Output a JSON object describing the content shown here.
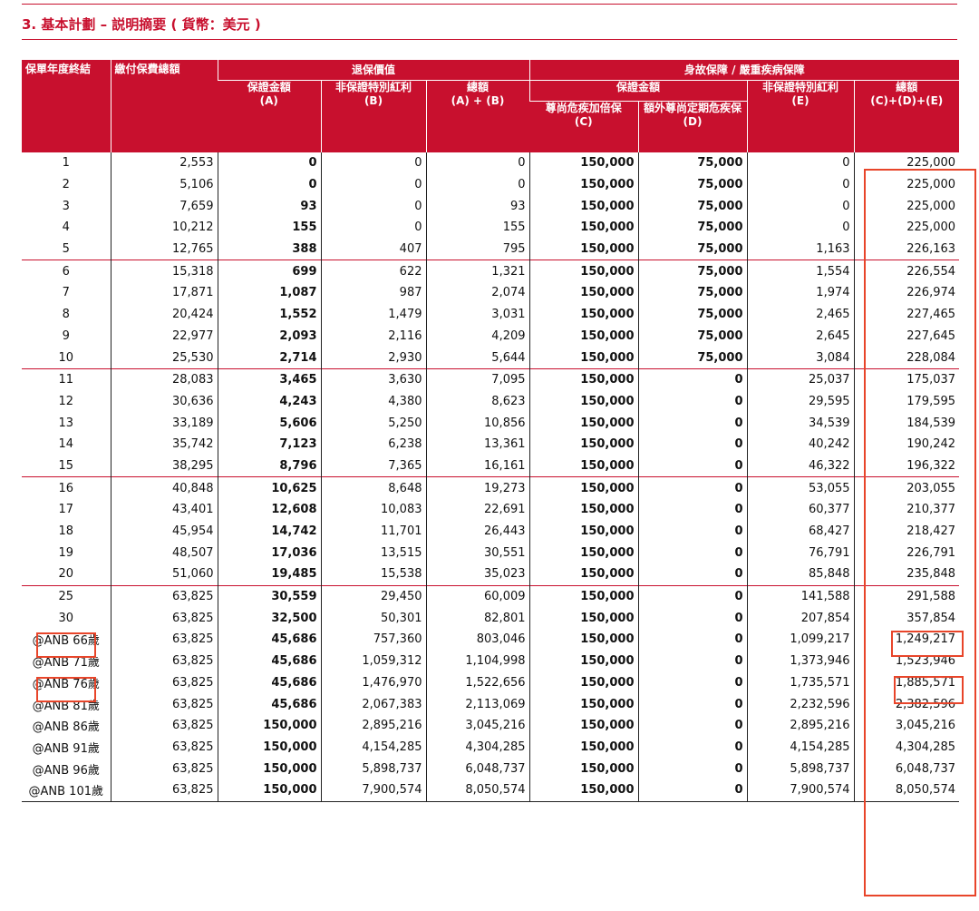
{
  "title": "3. 基本計劃 – 説明摘要 ( 貨幣：美元 )",
  "headers": {
    "policy_year": "保單年度終結",
    "premium": "繳付保費總額",
    "surrender_group": "退保價值",
    "death_group": "身故保障 / 嚴重疾病保障",
    "guaranteed": "保證金額",
    "guaranteed_code": "(A)",
    "nonguar_bonus": "非保證特別紅利",
    "nonguar_bonus_code": "(B)",
    "surrender_total": "總額",
    "surrender_total_code": "(A) + (B)",
    "death_guaranteed": "保證金額",
    "death_nonguar": "非保證特別紅利",
    "death_nonguar_code": "(E)",
    "death_total": "總額",
    "death_total_code": "(C)+(D)+(E)",
    "double_cover": "尊尚危疾加倍保",
    "double_cover_code": "(C)",
    "term_cover": "額外尊尚定期危疾保",
    "term_cover_code": "(D)"
  },
  "rows": [
    {
      "y": "1",
      "p": "2,553",
      "a": "0",
      "b": "0",
      "ab": "0",
      "c": "150,000",
      "d": "75,000",
      "e": "0",
      "t": "225,000"
    },
    {
      "y": "2",
      "p": "5,106",
      "a": "0",
      "b": "0",
      "ab": "0",
      "c": "150,000",
      "d": "75,000",
      "e": "0",
      "t": "225,000"
    },
    {
      "y": "3",
      "p": "7,659",
      "a": "93",
      "b": "0",
      "ab": "93",
      "c": "150,000",
      "d": "75,000",
      "e": "0",
      "t": "225,000"
    },
    {
      "y": "4",
      "p": "10,212",
      "a": "155",
      "b": "0",
      "ab": "155",
      "c": "150,000",
      "d": "75,000",
      "e": "0",
      "t": "225,000"
    },
    {
      "y": "5",
      "p": "12,765",
      "a": "388",
      "b": "407",
      "ab": "795",
      "c": "150,000",
      "d": "75,000",
      "e": "1,163",
      "t": "226,163"
    },
    {
      "y": "6",
      "p": "15,318",
      "a": "699",
      "b": "622",
      "ab": "1,321",
      "c": "150,000",
      "d": "75,000",
      "e": "1,554",
      "t": "226,554"
    },
    {
      "y": "7",
      "p": "17,871",
      "a": "1,087",
      "b": "987",
      "ab": "2,074",
      "c": "150,000",
      "d": "75,000",
      "e": "1,974",
      "t": "226,974"
    },
    {
      "y": "8",
      "p": "20,424",
      "a": "1,552",
      "b": "1,479",
      "ab": "3,031",
      "c": "150,000",
      "d": "75,000",
      "e": "2,465",
      "t": "227,465"
    },
    {
      "y": "9",
      "p": "22,977",
      "a": "2,093",
      "b": "2,116",
      "ab": "4,209",
      "c": "150,000",
      "d": "75,000",
      "e": "2,645",
      "t": "227,645"
    },
    {
      "y": "10",
      "p": "25,530",
      "a": "2,714",
      "b": "2,930",
      "ab": "5,644",
      "c": "150,000",
      "d": "75,000",
      "e": "3,084",
      "t": "228,084"
    },
    {
      "y": "11",
      "p": "28,083",
      "a": "3,465",
      "b": "3,630",
      "ab": "7,095",
      "c": "150,000",
      "d": "0",
      "e": "25,037",
      "t": "175,037"
    },
    {
      "y": "12",
      "p": "30,636",
      "a": "4,243",
      "b": "4,380",
      "ab": "8,623",
      "c": "150,000",
      "d": "0",
      "e": "29,595",
      "t": "179,595"
    },
    {
      "y": "13",
      "p": "33,189",
      "a": "5,606",
      "b": "5,250",
      "ab": "10,856",
      "c": "150,000",
      "d": "0",
      "e": "34,539",
      "t": "184,539"
    },
    {
      "y": "14",
      "p": "35,742",
      "a": "7,123",
      "b": "6,238",
      "ab": "13,361",
      "c": "150,000",
      "d": "0",
      "e": "40,242",
      "t": "190,242"
    },
    {
      "y": "15",
      "p": "38,295",
      "a": "8,796",
      "b": "7,365",
      "ab": "16,161",
      "c": "150,000",
      "d": "0",
      "e": "46,322",
      "t": "196,322"
    },
    {
      "y": "16",
      "p": "40,848",
      "a": "10,625",
      "b": "8,648",
      "ab": "19,273",
      "c": "150,000",
      "d": "0",
      "e": "53,055",
      "t": "203,055"
    },
    {
      "y": "17",
      "p": "43,401",
      "a": "12,608",
      "b": "10,083",
      "ab": "22,691",
      "c": "150,000",
      "d": "0",
      "e": "60,377",
      "t": "210,377"
    },
    {
      "y": "18",
      "p": "45,954",
      "a": "14,742",
      "b": "11,701",
      "ab": "26,443",
      "c": "150,000",
      "d": "0",
      "e": "68,427",
      "t": "218,427"
    },
    {
      "y": "19",
      "p": "48,507",
      "a": "17,036",
      "b": "13,515",
      "ab": "30,551",
      "c": "150,000",
      "d": "0",
      "e": "76,791",
      "t": "226,791"
    },
    {
      "y": "20",
      "p": "51,060",
      "a": "19,485",
      "b": "15,538",
      "ab": "35,023",
      "c": "150,000",
      "d": "0",
      "e": "85,848",
      "t": "235,848"
    },
    {
      "y": "25",
      "p": "63,825",
      "a": "30,559",
      "b": "29,450",
      "ab": "60,009",
      "c": "150,000",
      "d": "0",
      "e": "141,588",
      "t": "291,588"
    },
    {
      "y": "30",
      "p": "63,825",
      "a": "32,500",
      "b": "50,301",
      "ab": "82,801",
      "c": "150,000",
      "d": "0",
      "e": "207,854",
      "t": "357,854"
    },
    {
      "y": "@ANB 66歲",
      "p": "63,825",
      "a": "45,686",
      "b": "757,360",
      "ab": "803,046",
      "c": "150,000",
      "d": "0",
      "e": "1,099,217",
      "t": "1,249,217"
    },
    {
      "y": "@ANB 71歲",
      "p": "63,825",
      "a": "45,686",
      "b": "1,059,312",
      "ab": "1,104,998",
      "c": "150,000",
      "d": "0",
      "e": "1,373,946",
      "t": "1,523,946"
    },
    {
      "y": "@ANB 76歲",
      "p": "63,825",
      "a": "45,686",
      "b": "1,476,970",
      "ab": "1,522,656",
      "c": "150,000",
      "d": "0",
      "e": "1,735,571",
      "t": "1,885,571"
    },
    {
      "y": "@ANB 81歲",
      "p": "63,825",
      "a": "45,686",
      "b": "2,067,383",
      "ab": "2,113,069",
      "c": "150,000",
      "d": "0",
      "e": "2,232,596",
      "t": "2,382,596"
    },
    {
      "y": "@ANB 86歲",
      "p": "63,825",
      "a": "150,000",
      "b": "2,895,216",
      "ab": "3,045,216",
      "c": "150,000",
      "d": "0",
      "e": "2,895,216",
      "t": "3,045,216"
    },
    {
      "y": "@ANB 91歲",
      "p": "63,825",
      "a": "150,000",
      "b": "4,154,285",
      "ab": "4,304,285",
      "c": "150,000",
      "d": "0",
      "e": "4,154,285",
      "t": "4,304,285"
    },
    {
      "y": "@ANB 96歲",
      "p": "63,825",
      "a": "150,000",
      "b": "5,898,737",
      "ab": "6,048,737",
      "c": "150,000",
      "d": "0",
      "e": "5,898,737",
      "t": "6,048,737"
    },
    {
      "y": "@ANB 101歲",
      "p": "63,825",
      "a": "150,000",
      "b": "7,900,574",
      "ab": "8,050,574",
      "c": "150,000",
      "d": "0",
      "e": "7,900,574",
      "t": "8,050,574"
    }
  ],
  "group_starts": [
    0,
    5,
    10,
    15,
    20
  ],
  "highlight_color": "#e8452a",
  "accent_color": "#c8102e"
}
